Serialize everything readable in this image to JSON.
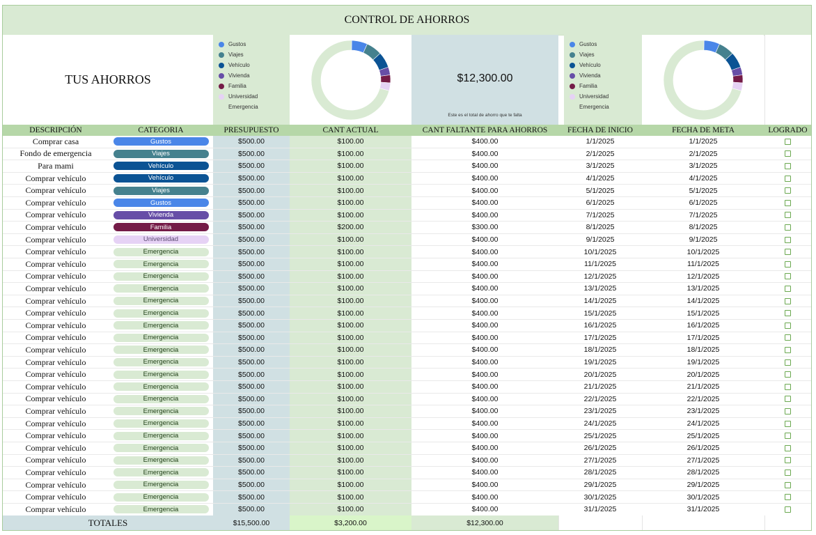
{
  "title": "CONTROL DE AHORROS",
  "tus_ahorros": "TUS AHORROS",
  "summary": {
    "total_remaining": "$12,300.00",
    "caption": "Este es el total de ahorro que te falta"
  },
  "legend": [
    {
      "label": "Gustos",
      "color": "#4a86e8"
    },
    {
      "label": "Viajes",
      "color": "#45818e"
    },
    {
      "label": "Vehículo",
      "color": "#0b5394"
    },
    {
      "label": "Vivienda",
      "color": "#674ea7"
    },
    {
      "label": "Familia",
      "color": "#741b47"
    },
    {
      "label": "Universidad",
      "color": "#e6d2f5"
    },
    {
      "label": "Emergencia",
      "color": "#d9ead3"
    }
  ],
  "chart_data": [
    {
      "type": "pie",
      "donut": true,
      "categories": [
        "Gustos",
        "Viajes",
        "Vehículo",
        "Vivienda",
        "Familia",
        "Universidad",
        "Emergencia"
      ],
      "values": [
        2,
        2,
        2,
        1,
        1,
        1,
        22
      ],
      "colors": [
        "#4a86e8",
        "#45818e",
        "#0b5394",
        "#674ea7",
        "#741b47",
        "#e6d2f5",
        "#d9ead3"
      ],
      "legend": "left"
    },
    {
      "type": "pie",
      "donut": true,
      "categories": [
        "Gustos",
        "Viajes",
        "Vehículo",
        "Vivienda",
        "Familia",
        "Universidad",
        "Emergencia"
      ],
      "values": [
        2,
        2,
        2,
        1,
        1,
        1,
        22
      ],
      "colors": [
        "#4a86e8",
        "#45818e",
        "#0b5394",
        "#674ea7",
        "#741b47",
        "#e6d2f5",
        "#d9ead3"
      ],
      "legend": "left"
    }
  ],
  "category_styles": {
    "Gustos": {
      "bg": "#4a86e8",
      "fg": "#ffffff"
    },
    "Viajes": {
      "bg": "#45818e",
      "fg": "#ffffff"
    },
    "Vehículo": {
      "bg": "#0b5394",
      "fg": "#ffffff"
    },
    "Vivienda": {
      "bg": "#674ea7",
      "fg": "#ffffff"
    },
    "Familia": {
      "bg": "#741b47",
      "fg": "#ffffff"
    },
    "Universidad": {
      "bg": "#e6d2f5",
      "fg": "#5b4a72"
    },
    "Emergencia": {
      "bg": "#d9ead3",
      "fg": "#1f3f16"
    }
  },
  "columns": [
    "DESCRIPCIÓN",
    "CATEGORIA",
    "PRESUPUESTO",
    "CANT ACTUAL",
    "CANT FALTANTE PARA AHORROS",
    "FECHA DE INICIO",
    "FECHA DE META",
    "LOGRADO"
  ],
  "rows": [
    {
      "descripcion": "Comprar casa",
      "categoria": "Gustos",
      "presupuesto": "$500.00",
      "actual": "$100.00",
      "faltante": "$400.00",
      "inicio": "1/1/2025",
      "meta": "1/1/2025",
      "logrado": false
    },
    {
      "descripcion": "Fondo de emergencia",
      "categoria": "Viajes",
      "presupuesto": "$500.00",
      "actual": "$100.00",
      "faltante": "$400.00",
      "inicio": "2/1/2025",
      "meta": "2/1/2025",
      "logrado": false
    },
    {
      "descripcion": "Para mami",
      "categoria": "Vehículo",
      "presupuesto": "$500.00",
      "actual": "$100.00",
      "faltante": "$400.00",
      "inicio": "3/1/2025",
      "meta": "3/1/2025",
      "logrado": false
    },
    {
      "descripcion": "Comprar vehículo",
      "categoria": "Vehículo",
      "presupuesto": "$500.00",
      "actual": "$100.00",
      "faltante": "$400.00",
      "inicio": "4/1/2025",
      "meta": "4/1/2025",
      "logrado": false
    },
    {
      "descripcion": "Comprar vehículo",
      "categoria": "Viajes",
      "presupuesto": "$500.00",
      "actual": "$100.00",
      "faltante": "$400.00",
      "inicio": "5/1/2025",
      "meta": "5/1/2025",
      "logrado": false
    },
    {
      "descripcion": "Comprar vehículo",
      "categoria": "Gustos",
      "presupuesto": "$500.00",
      "actual": "$100.00",
      "faltante": "$400.00",
      "inicio": "6/1/2025",
      "meta": "6/1/2025",
      "logrado": false
    },
    {
      "descripcion": "Comprar vehículo",
      "categoria": "Vivienda",
      "presupuesto": "$500.00",
      "actual": "$100.00",
      "faltante": "$400.00",
      "inicio": "7/1/2025",
      "meta": "7/1/2025",
      "logrado": false
    },
    {
      "descripcion": "Comprar vehículo",
      "categoria": "Familia",
      "presupuesto": "$500.00",
      "actual": "$200.00",
      "faltante": "$300.00",
      "inicio": "8/1/2025",
      "meta": "8/1/2025",
      "logrado": false
    },
    {
      "descripcion": "Comprar vehículo",
      "categoria": "Universidad",
      "presupuesto": "$500.00",
      "actual": "$100.00",
      "faltante": "$400.00",
      "inicio": "9/1/2025",
      "meta": "9/1/2025",
      "logrado": false
    },
    {
      "descripcion": "Comprar vehículo",
      "categoria": "Emergencia",
      "presupuesto": "$500.00",
      "actual": "$100.00",
      "faltante": "$400.00",
      "inicio": "10/1/2025",
      "meta": "10/1/2025",
      "logrado": false
    },
    {
      "descripcion": "Comprar vehículo",
      "categoria": "Emergencia",
      "presupuesto": "$500.00",
      "actual": "$100.00",
      "faltante": "$400.00",
      "inicio": "11/1/2025",
      "meta": "11/1/2025",
      "logrado": false
    },
    {
      "descripcion": "Comprar vehículo",
      "categoria": "Emergencia",
      "presupuesto": "$500.00",
      "actual": "$100.00",
      "faltante": "$400.00",
      "inicio": "12/1/2025",
      "meta": "12/1/2025",
      "logrado": false
    },
    {
      "descripcion": "Comprar vehículo",
      "categoria": "Emergencia",
      "presupuesto": "$500.00",
      "actual": "$100.00",
      "faltante": "$400.00",
      "inicio": "13/1/2025",
      "meta": "13/1/2025",
      "logrado": false
    },
    {
      "descripcion": "Comprar vehículo",
      "categoria": "Emergencia",
      "presupuesto": "$500.00",
      "actual": "$100.00",
      "faltante": "$400.00",
      "inicio": "14/1/2025",
      "meta": "14/1/2025",
      "logrado": false
    },
    {
      "descripcion": "Comprar vehículo",
      "categoria": "Emergencia",
      "presupuesto": "$500.00",
      "actual": "$100.00",
      "faltante": "$400.00",
      "inicio": "15/1/2025",
      "meta": "15/1/2025",
      "logrado": false
    },
    {
      "descripcion": "Comprar vehículo",
      "categoria": "Emergencia",
      "presupuesto": "$500.00",
      "actual": "$100.00",
      "faltante": "$400.00",
      "inicio": "16/1/2025",
      "meta": "16/1/2025",
      "logrado": false
    },
    {
      "descripcion": "Comprar vehículo",
      "categoria": "Emergencia",
      "presupuesto": "$500.00",
      "actual": "$100.00",
      "faltante": "$400.00",
      "inicio": "17/1/2025",
      "meta": "17/1/2025",
      "logrado": false
    },
    {
      "descripcion": "Comprar vehículo",
      "categoria": "Emergencia",
      "presupuesto": "$500.00",
      "actual": "$100.00",
      "faltante": "$400.00",
      "inicio": "18/1/2025",
      "meta": "18/1/2025",
      "logrado": false
    },
    {
      "descripcion": "Comprar vehículo",
      "categoria": "Emergencia",
      "presupuesto": "$500.00",
      "actual": "$100.00",
      "faltante": "$400.00",
      "inicio": "19/1/2025",
      "meta": "19/1/2025",
      "logrado": false
    },
    {
      "descripcion": "Comprar vehículo",
      "categoria": "Emergencia",
      "presupuesto": "$500.00",
      "actual": "$100.00",
      "faltante": "$400.00",
      "inicio": "20/1/2025",
      "meta": "20/1/2025",
      "logrado": false
    },
    {
      "descripcion": "Comprar vehículo",
      "categoria": "Emergencia",
      "presupuesto": "$500.00",
      "actual": "$100.00",
      "faltante": "$400.00",
      "inicio": "21/1/2025",
      "meta": "21/1/2025",
      "logrado": false
    },
    {
      "descripcion": "Comprar vehículo",
      "categoria": "Emergencia",
      "presupuesto": "$500.00",
      "actual": "$100.00",
      "faltante": "$400.00",
      "inicio": "22/1/2025",
      "meta": "22/1/2025",
      "logrado": false
    },
    {
      "descripcion": "Comprar vehículo",
      "categoria": "Emergencia",
      "presupuesto": "$500.00",
      "actual": "$100.00",
      "faltante": "$400.00",
      "inicio": "23/1/2025",
      "meta": "23/1/2025",
      "logrado": false
    },
    {
      "descripcion": "Comprar vehículo",
      "categoria": "Emergencia",
      "presupuesto": "$500.00",
      "actual": "$100.00",
      "faltante": "$400.00",
      "inicio": "24/1/2025",
      "meta": "24/1/2025",
      "logrado": false
    },
    {
      "descripcion": "Comprar vehículo",
      "categoria": "Emergencia",
      "presupuesto": "$500.00",
      "actual": "$100.00",
      "faltante": "$400.00",
      "inicio": "25/1/2025",
      "meta": "25/1/2025",
      "logrado": false
    },
    {
      "descripcion": "Comprar vehículo",
      "categoria": "Emergencia",
      "presupuesto": "$500.00",
      "actual": "$100.00",
      "faltante": "$400.00",
      "inicio": "26/1/2025",
      "meta": "26/1/2025",
      "logrado": false
    },
    {
      "descripcion": "Comprar vehículo",
      "categoria": "Emergencia",
      "presupuesto": "$500.00",
      "actual": "$100.00",
      "faltante": "$400.00",
      "inicio": "27/1/2025",
      "meta": "27/1/2025",
      "logrado": false
    },
    {
      "descripcion": "Comprar vehículo",
      "categoria": "Emergencia",
      "presupuesto": "$500.00",
      "actual": "$100.00",
      "faltante": "$400.00",
      "inicio": "28/1/2025",
      "meta": "28/1/2025",
      "logrado": false
    },
    {
      "descripcion": "Comprar vehículo",
      "categoria": "Emergencia",
      "presupuesto": "$500.00",
      "actual": "$100.00",
      "faltante": "$400.00",
      "inicio": "29/1/2025",
      "meta": "29/1/2025",
      "logrado": false
    },
    {
      "descripcion": "Comprar vehículo",
      "categoria": "Emergencia",
      "presupuesto": "$500.00",
      "actual": "$100.00",
      "faltante": "$400.00",
      "inicio": "30/1/2025",
      "meta": "30/1/2025",
      "logrado": false
    },
    {
      "descripcion": "Comprar vehículo",
      "categoria": "Emergencia",
      "presupuesto": "$500.00",
      "actual": "$100.00",
      "faltante": "$400.00",
      "inicio": "31/1/2025",
      "meta": "31/1/2025",
      "logrado": false
    }
  ],
  "totals": {
    "label": "TOTALES",
    "presupuesto": "$15,500.00",
    "actual": "$3,200.00",
    "faltante": "$12,300.00"
  },
  "colors": {
    "header_green": "#b6d7a8",
    "light_green": "#d9ead3",
    "light_blue": "#d0e0e3",
    "checkbox_green": "#6aa84f"
  }
}
